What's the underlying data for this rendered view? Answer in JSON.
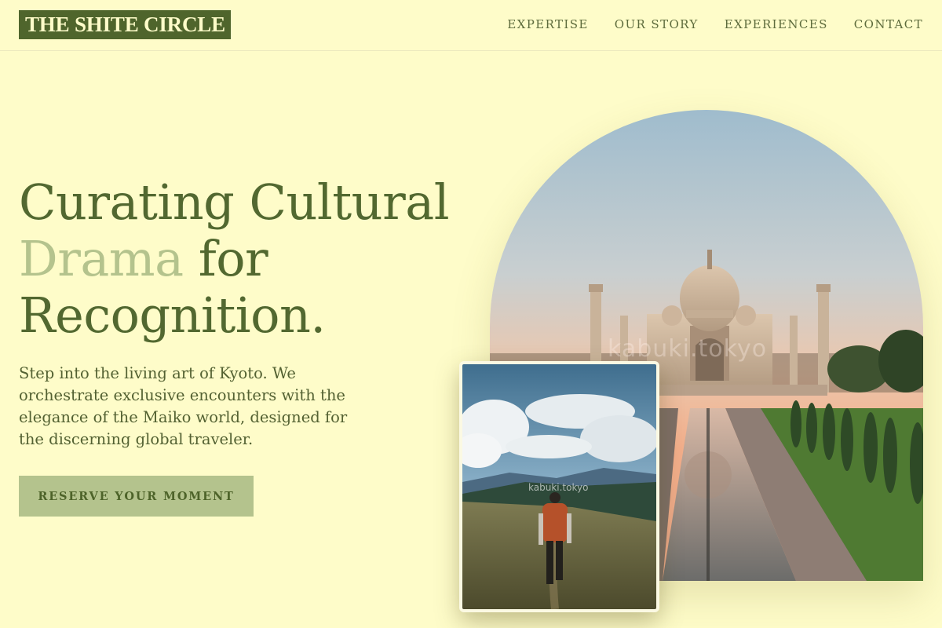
{
  "header": {
    "logo": "THE SHITE CIRCLE",
    "nav": [
      {
        "label": "EXPERTISE"
      },
      {
        "label": "OUR STORY"
      },
      {
        "label": "EXPERIENCES"
      },
      {
        "label": "CONTACT"
      }
    ]
  },
  "hero": {
    "title_line1": "Curating Cultural",
    "title_accent": "Drama",
    "title_line2_rest": " for",
    "title_line3": "Recognition.",
    "subtitle": "Step into the living art of Kyoto. We orchestrate exclusive encounters with the elegance of the Maiko world, designed for the discerning global traveler.",
    "cta_label": "RESERVE YOUR MOMENT"
  },
  "images": {
    "arch_watermark": "kabuki.tokyo",
    "photo_watermark": "kabuki.tokyo"
  },
  "colors": {
    "background": "#fefcc9",
    "primary": "#4f652c",
    "accent": "#b4c38d"
  }
}
